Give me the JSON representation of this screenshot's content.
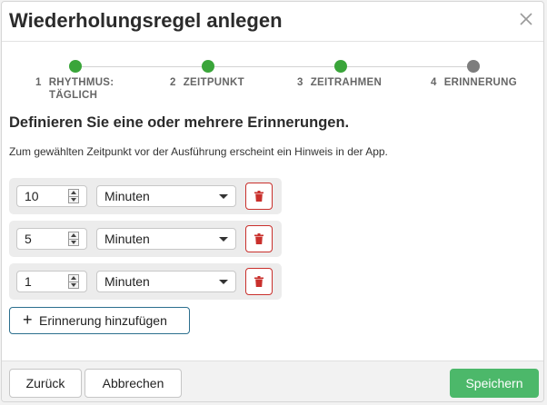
{
  "dialog": {
    "title": "Wiederholungsregel anlegen",
    "close_icon": "close-icon"
  },
  "steps": [
    {
      "num": "1",
      "label": "RHYTHMUS:",
      "label_cont": "TÄGLICH",
      "status": "completed",
      "color": "#3aa53a"
    },
    {
      "num": "2",
      "label": "ZEITPUNKT",
      "label_cont": "",
      "status": "completed",
      "color": "#3aa53a"
    },
    {
      "num": "3",
      "label": "ZEITRAHMEN",
      "label_cont": "",
      "status": "completed",
      "color": "#3aa53a"
    },
    {
      "num": "4",
      "label": "ERINNERUNG",
      "label_cont": "",
      "status": "current",
      "color": "#7d7d7d"
    }
  ],
  "content": {
    "heading": "Definieren Sie eine oder mehrere Erinnerungen.",
    "description": "Zum gewählten Zeitpunkt vor der Ausführung erscheint ein Hinweis in der App."
  },
  "reminders": [
    {
      "value": "10",
      "unit": "Minuten"
    },
    {
      "value": "5",
      "unit": "Minuten"
    },
    {
      "value": "1",
      "unit": "Minuten"
    }
  ],
  "add_button": {
    "label": "Erinnerung hinzufügen",
    "icon": "plus-icon"
  },
  "footer": {
    "back_label": "Zurück",
    "cancel_label": "Abbrechen",
    "save_label": "Speichern"
  },
  "colors": {
    "accent_green": "#4cb86a",
    "danger": "#c9302c",
    "outline_blue": "#2c6f8e"
  }
}
